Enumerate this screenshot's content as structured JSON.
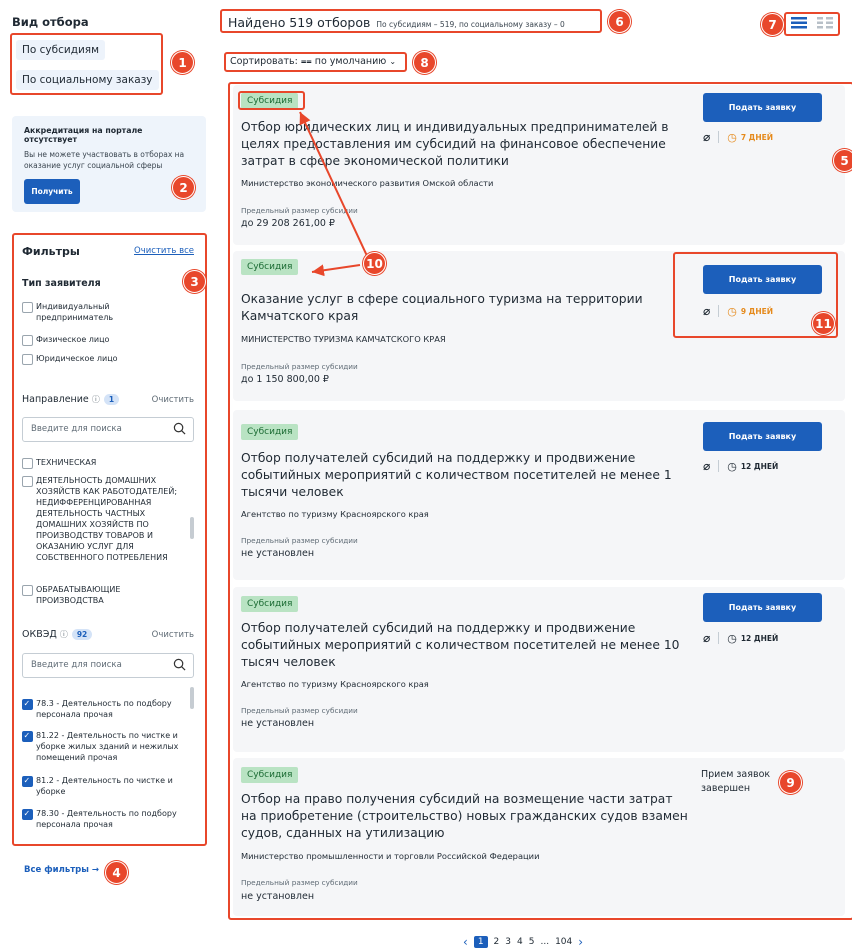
{
  "sidebar": {
    "heading": "Вид отбора",
    "types": [
      "По субсидиям",
      "По социальному заказу"
    ],
    "accreditation": {
      "title": "Аккредитация на портале отсутствует",
      "text": "Вы не можете участвовать в отборах на оказание услуг социальной сферы",
      "button": "Получить"
    },
    "filters": {
      "title": "Фильтры",
      "clear_all": "Очистить все",
      "applicant_label": "Тип заявителя",
      "applicants": [
        "Индивидуальный предприниматель",
        "Физическое лицо",
        "Юридическое лицо"
      ],
      "direction_label": "Направление",
      "direction_count": "1",
      "clear": "Очистить",
      "search_placeholder": "Введите для поиска",
      "direction_items": [
        "ТЕХНИЧЕСКАЯ",
        "ДЕЯТЕЛЬНОСТЬ ДОМАШНИХ ХОЗЯЙСТВ КАК РАБОТОДАТЕЛЕЙ; НЕДИФФЕРЕНЦИРОВАННАЯ ДЕЯТЕЛЬНОСТЬ ЧАСТНЫХ ДОМАШНИХ ХОЗЯЙСТВ ПО ПРОИЗВОДСТВУ ТОВАРОВ И ОКАЗАНИЮ УСЛУГ ДЛЯ СОБСТВЕННОГО ПОТРЕБЛЕНИЯ",
        "ОБРАБАТЫВАЮЩИЕ ПРОИЗВОДСТВА"
      ],
      "okved_label": "ОКВЭД",
      "okved_count": "92",
      "okved_items": [
        "78.3 - Деятельность по подбору персонала прочая",
        "81.22 - Деятельность по чистке и уборке жилых зданий и нежилых помещений прочая",
        "81.2 - Деятельность по чистке и уборке",
        "78.30 - Деятельность по подбору персонала прочая"
      ]
    },
    "all_filters": "Все фильтры"
  },
  "header": {
    "found": "Найдено 519 отборов",
    "found_sub": "По субсидиям – 519, по социальному заказу – 0",
    "sort_label": "Сортировать:",
    "sort_value": "по умолчанию"
  },
  "cards": [
    {
      "tag": "Субсидия",
      "title": "Отбор юридических лиц и индивидуальных предпринимателей в целях предоставления им субсидий на финансовое обеспечение затрат в сфере экономической политики",
      "org": "Министерство экономического развития Омской области",
      "max_label": "Предельный размер субсидии",
      "max_value": "до 29 208 261,00 ₽",
      "button": "Подать заявку",
      "days": "7 ДНЕЙ",
      "days_color": "#e58a1c"
    },
    {
      "tag": "Субсидия",
      "title": "Оказание услуг в сфере социального туризма на территории Камчатского края",
      "org": "МИНИСТЕРСТВО ТУРИЗМА КАМЧАТСКОГО КРАЯ",
      "max_label": "Предельный размер субсидии",
      "max_value": "до 1 150 800,00 ₽",
      "button": "Подать заявку",
      "days": "9 ДНЕЙ",
      "days_color": "#e58a1c"
    },
    {
      "tag": "Субсидия",
      "title": "Отбор получателей субсидий на поддержку и продвижение событийных мероприятий с количеством посетителей не менее 1 тысячи человек",
      "org": "Агентство по туризму Красноярского края",
      "max_label": "Предельный размер субсидии",
      "max_value": "не установлен",
      "button": "Подать заявку",
      "days": "12 ДНЕЙ",
      "days_color": "#1f2933"
    },
    {
      "tag": "Субсидия",
      "title": "Отбор получателей субсидий на поддержку и продвижение событийных мероприятий с количеством посетителей не менее 10 тысяч человек",
      "org": "Агентство по туризму Красноярского края",
      "max_label": "Предельный размер субсидии",
      "max_value": "не установлен",
      "button": "Подать заявку",
      "days": "12 ДНЕЙ",
      "days_color": "#1f2933"
    },
    {
      "tag": "Субсидия",
      "title": "Отбор на право получения субсидий на возмещение части затрат на приобретение (строительство) новых гражданских судов взамен судов, сданных на утилизацию",
      "org": "Министерство промышленности и торговли Российской Федерации",
      "max_label": "Предельный размер субсидии",
      "max_value": "не установлен",
      "ended": "Прием заявок завершен"
    }
  ],
  "pagination": {
    "pages": [
      "1",
      "2",
      "3",
      "4",
      "5",
      "...",
      "104"
    ]
  },
  "markers": [
    "1",
    "2",
    "3",
    "4",
    "5",
    "6",
    "7",
    "8",
    "9",
    "10",
    "11"
  ],
  "colors": {
    "accent": "#1c5fbb",
    "marker": "#e8472b",
    "tag_bg": "#b9e3c3",
    "tag_text": "#1b6b33"
  }
}
